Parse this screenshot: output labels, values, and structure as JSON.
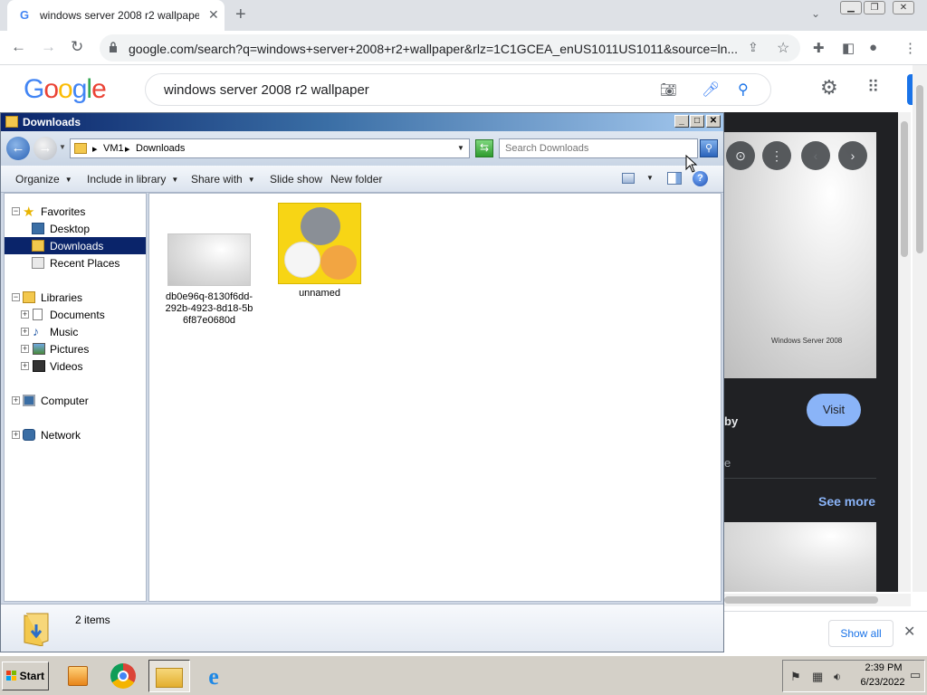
{
  "browser": {
    "tab_title": "windows server 2008 r2 wallpaper",
    "url": "google.com/search?q=windows+server+2008+r2+wallpaper&rlz=1C1GCEA_enUS1011US1011&source=ln...",
    "new_tab": "+",
    "tab_close": "✕"
  },
  "google": {
    "logo": "Google",
    "query": "windows server 2008 r2 wallpaper",
    "panel": {
      "thumb_caption": "Windows Server 2008",
      "by_text": "by",
      "e_text": "e",
      "visit_label": "Visit",
      "see_more_label": "See more"
    },
    "downloads_bar": {
      "show_all_label": "Show all"
    }
  },
  "explorer": {
    "title": "Downloads",
    "breadcrumb": [
      "VM1",
      "Downloads"
    ],
    "search_placeholder": "Search Downloads",
    "commands": {
      "organize": "Organize",
      "include_in_library": "Include in library",
      "share_with": "Share with",
      "slide_show": "Slide show",
      "new_folder": "New folder"
    },
    "nav": {
      "favorites": "Favorites",
      "desktop": "Desktop",
      "downloads": "Downloads",
      "recent_places": "Recent Places",
      "libraries": "Libraries",
      "documents": "Documents",
      "music": "Music",
      "pictures": "Pictures",
      "videos": "Videos",
      "computer": "Computer",
      "network": "Network"
    },
    "files": [
      {
        "name": "db0e96q-8130f6dd-292b-4923-8d18-5b6f87e0680d",
        "type": "image-wallpaper"
      },
      {
        "name": "unnamed",
        "type": "image-cats"
      }
    ],
    "status_count": "2 items"
  },
  "taskbar": {
    "start_label": "Start",
    "time": "2:39 PM",
    "date": "6/23/2022"
  },
  "colors": {
    "google_blue": "#4285f4",
    "explorer_title_start": "#0a246a",
    "selection": "#0a246a",
    "panel_dark": "#202124",
    "visit_button": "#8ab4f8"
  }
}
